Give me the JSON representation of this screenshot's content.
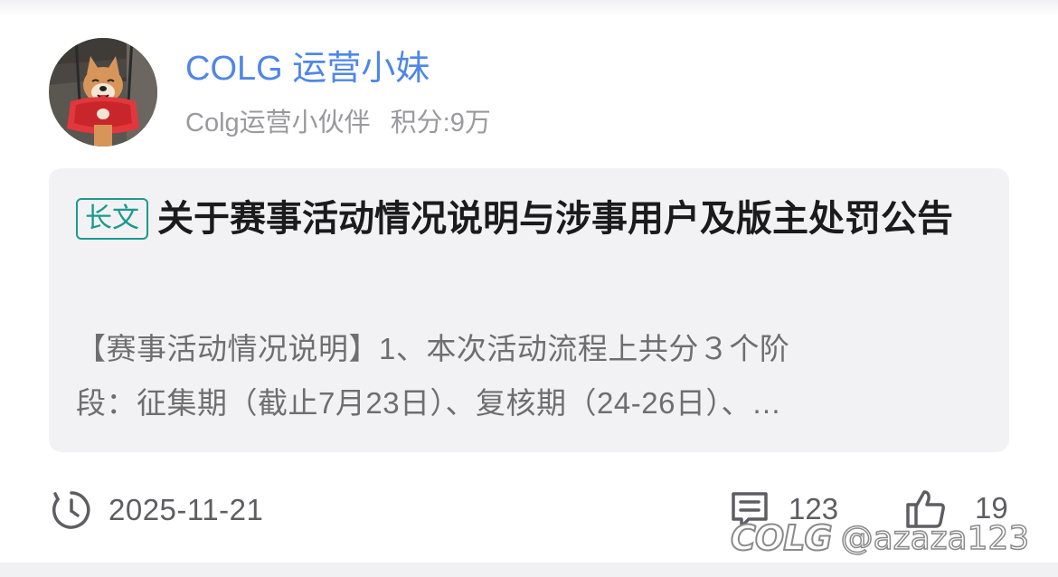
{
  "post": {
    "author": {
      "name": "COLG 运营小妹",
      "role": "Colg运营小伙伴",
      "points": "积分:9万"
    },
    "badge": "长文",
    "title": "关于赛事活动情况说明与涉事用户及版主处罚公告",
    "excerpt_line1": "【赛事活动情况说明】1、本次活动流程上共分３个阶",
    "excerpt_line2": "段：征集期（截止7月23日）、复核期（24-26日）、…",
    "date": "2025-11-21",
    "comments_count": "123",
    "likes_count": "19"
  },
  "watermark": {
    "logo": "COLG",
    "handle": "@azaza123"
  },
  "icons": {
    "avatar": "shiba-dog-in-red-swing-avatar",
    "clock": "clock-icon",
    "comment": "comment-icon",
    "like": "thumbs-up-icon"
  },
  "colors": {
    "username": "#4f86e8",
    "badge": "#1a9a8f",
    "card_bg": "#f2f2f4"
  }
}
